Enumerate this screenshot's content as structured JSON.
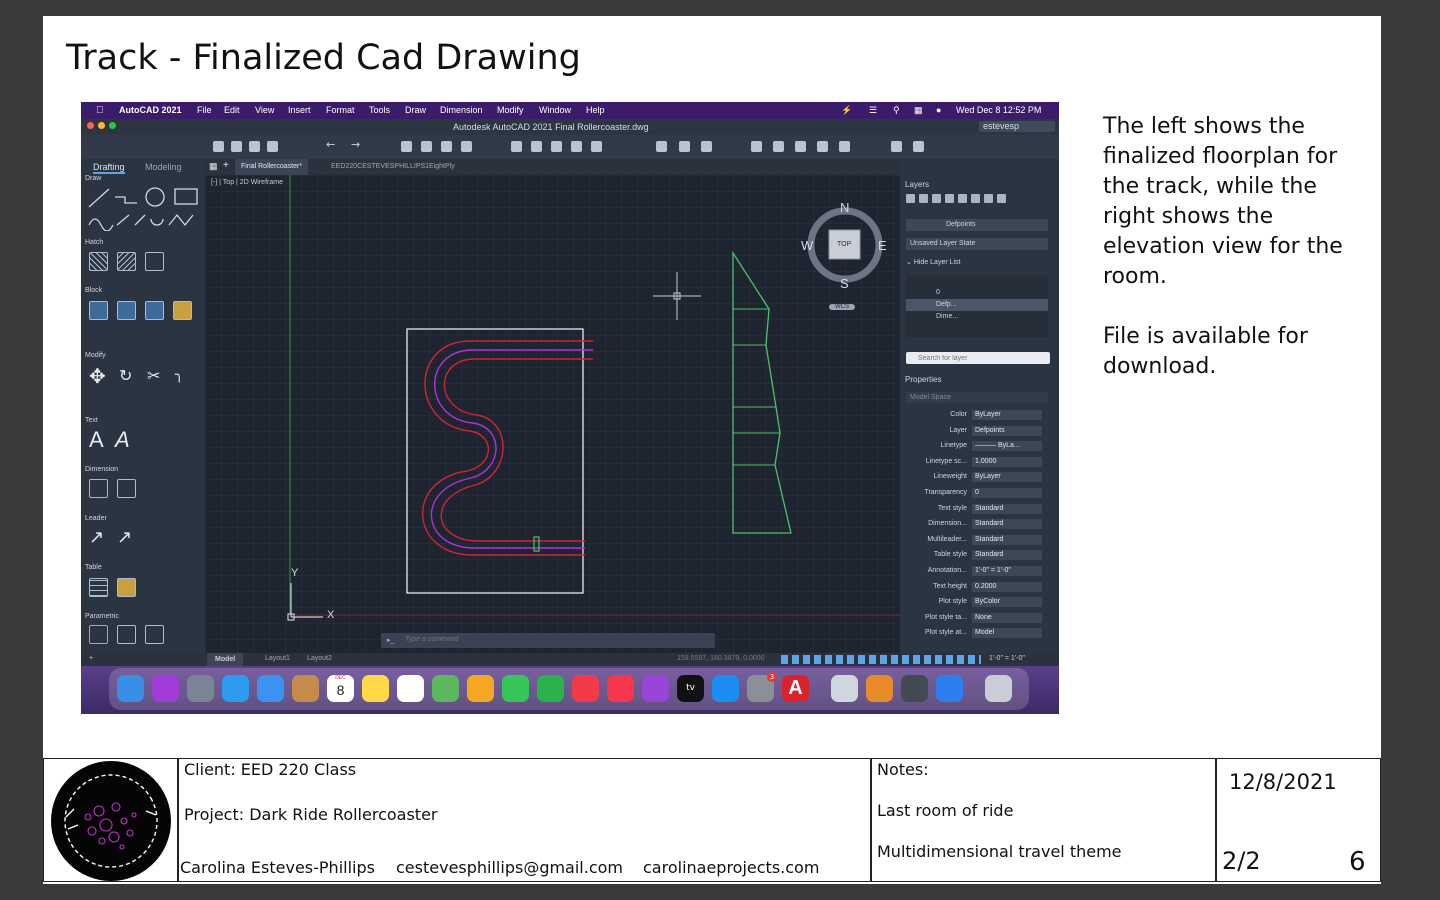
{
  "slide_title": "Track - Finalized Cad Drawing",
  "description": {
    "paragraph1": "The left shows the finalized floorplan for the track, while the right shows the elevation view for the room.",
    "paragraph2": "File is available for download."
  },
  "cad_screenshot": {
    "menubar": {
      "app_name": "AutoCAD 2021",
      "items": [
        "File",
        "Edit",
        "View",
        "Insert",
        "Format",
        "Tools",
        "Draw",
        "Dimension",
        "Modify",
        "Window",
        "Help"
      ],
      "clock": "Wed Dec 8  12:52 PM"
    },
    "window_title": "Autodesk AutoCAD 2021   Final Rollercoaster.dwg",
    "user": "estevesp",
    "ribbon_tabs": [
      "Drafting",
      "Modeling"
    ],
    "ribbon_panels": [
      "Draw",
      "Hatch",
      "Block",
      "Modify",
      "Text",
      "Dimension",
      "Leader",
      "Table",
      "Parametric"
    ],
    "doc_tabs": [
      "Final Rollercoaster*",
      "EED220CESTEVESPHILLIPS1EightPly"
    ],
    "viewport_label": "[-] | Top | 2D Wireframe",
    "viewcube": {
      "top": "TOP",
      "n": "N",
      "s": "S",
      "e": "E",
      "w": "W",
      "wcs": "WCS"
    },
    "ucs": {
      "x": "X",
      "y": "Y"
    },
    "command_placeholder": "Type a command",
    "layers": {
      "title": "Layers",
      "current_layer": "Defpoints",
      "layer_state": "Unsaved Layer State",
      "hide_list": "Hide Layer List",
      "rows": [
        "0",
        "Defp...",
        "Dime..."
      ],
      "search_placeholder": "Search for layer"
    },
    "properties": {
      "title": "Properties",
      "space": "Model Space",
      "rows": [
        {
          "label": "Color",
          "value": "ByLayer"
        },
        {
          "label": "Layer",
          "value": "Defpoints"
        },
        {
          "label": "Linetype",
          "value": "——— ByLa..."
        },
        {
          "label": "Linetype sc...",
          "value": "1.0000"
        },
        {
          "label": "Lineweight",
          "value": "ByLayer"
        },
        {
          "label": "Transparency",
          "value": "0"
        },
        {
          "label": "Text style",
          "value": "Standard"
        },
        {
          "label": "Dimension...",
          "value": "Standard"
        },
        {
          "label": "Multileader...",
          "value": "Standard"
        },
        {
          "label": "Table style",
          "value": "Standard"
        },
        {
          "label": "Annotation...",
          "value": "1'-0\" = 1'-0\""
        },
        {
          "label": "Text height",
          "value": "0.2000"
        },
        {
          "label": "Plot style",
          "value": "ByColor"
        },
        {
          "label": "Plot style ta...",
          "value": "None"
        },
        {
          "label": "Plot style at...",
          "value": "Model"
        }
      ]
    },
    "status": {
      "tabs": [
        "Model",
        "Layout1",
        "Layout2"
      ],
      "coords": "159.5597, 180.3879, 0.0000",
      "scale": "1'-0\" = 1'-0\""
    },
    "dock_calendar": {
      "month": "DEC",
      "day": "8"
    },
    "dock_badge": "3"
  },
  "title_block": {
    "client": "Client: EED 220 Class",
    "project": "Project: Dark Ride Rollercoaster",
    "author": "Carolina Esteves-Phillips",
    "email": "cestevesphillips@gmail.com",
    "website": "carolinaeprojects.com",
    "notes_label": "Notes:",
    "note1": "Last room of ride",
    "note2": "Multidimensional travel theme",
    "date": "12/8/2021",
    "page": "2/2",
    "sheet": "6"
  },
  "colors": {
    "canvas_bg": "#1e2530",
    "track_red": "#d0233a",
    "track_magenta": "#b232d8",
    "elevation_green": "#4fc06a",
    "menubar_purple": "#3b1c6a",
    "logo_magenta": "#c62fd6"
  }
}
